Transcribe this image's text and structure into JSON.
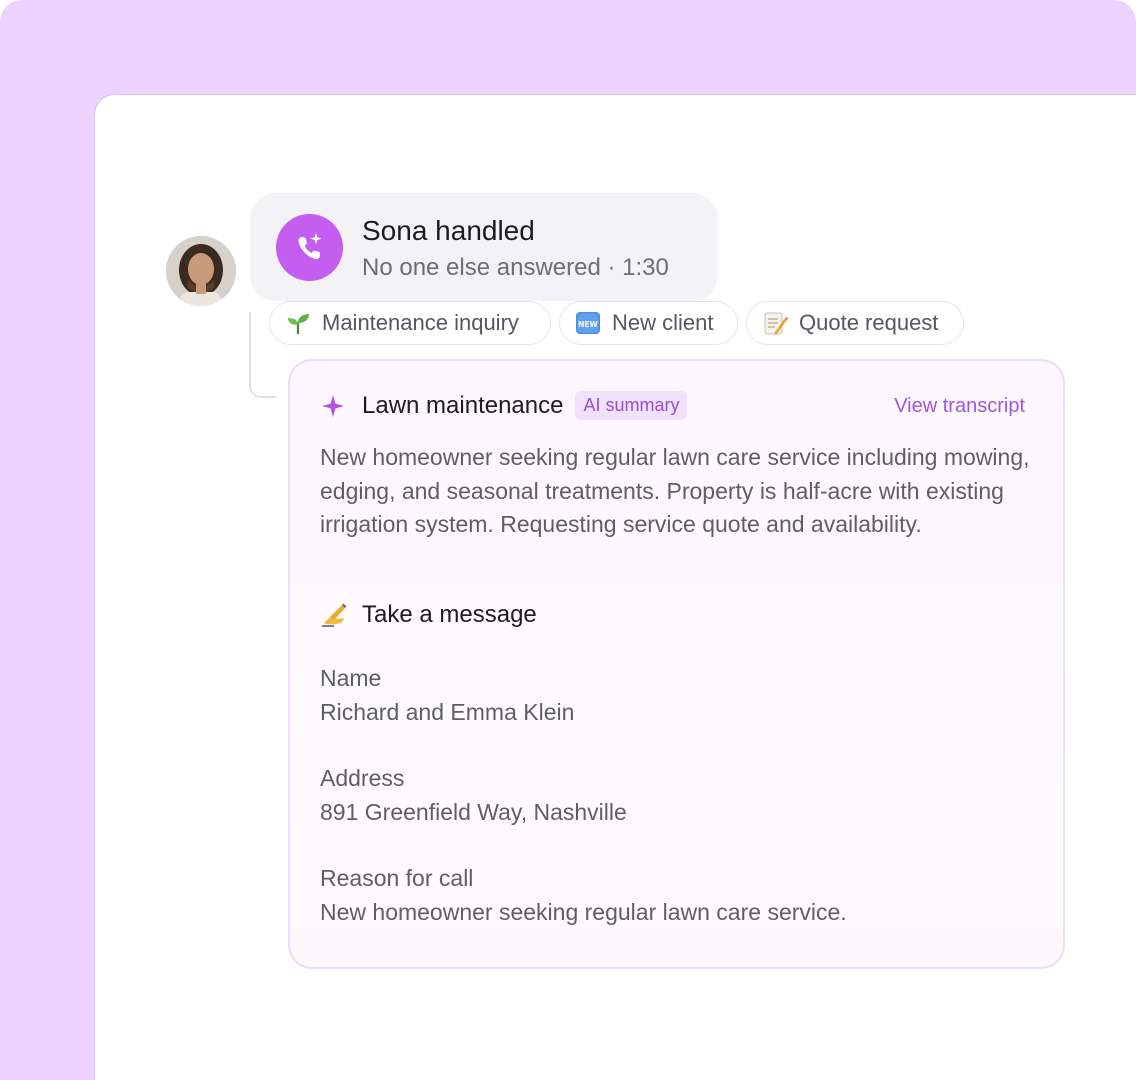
{
  "colors": {
    "background": "#ecd3fd",
    "accent": "#c45ef0",
    "link": "#a056de",
    "badge_bg": "#f1e1fb"
  },
  "caller": {
    "avatar_icon": "caller-avatar"
  },
  "status": {
    "icon": "phone-sparkle-icon",
    "title": "Sona handled",
    "subtitle": "No one else answered · 1:30"
  },
  "tags": [
    {
      "icon": "seedling-icon",
      "label": "Maintenance inquiry"
    },
    {
      "icon": "new-badge-icon",
      "label": "New client"
    },
    {
      "icon": "memo-icon",
      "label": "Quote request"
    }
  ],
  "summary": {
    "icon": "sparkle-icon",
    "title": "Lawn maintenance",
    "badge": "AI summary",
    "view_transcript": "View transcript",
    "text": "New homeowner seeking regular lawn care service including mowing, edging, and seasonal treatments. Property is half-acre with existing irrigation system. Requesting service quote and availability."
  },
  "message": {
    "icon": "writing-hand-icon",
    "title": "Take a message",
    "fields": [
      {
        "label": "Name",
        "value": "Richard and Emma Klein"
      },
      {
        "label": "Address",
        "value": "891 Greenfield Way, Nashville"
      },
      {
        "label": "Reason for call",
        "value": "New homeowner seeking regular lawn care service."
      }
    ]
  }
}
